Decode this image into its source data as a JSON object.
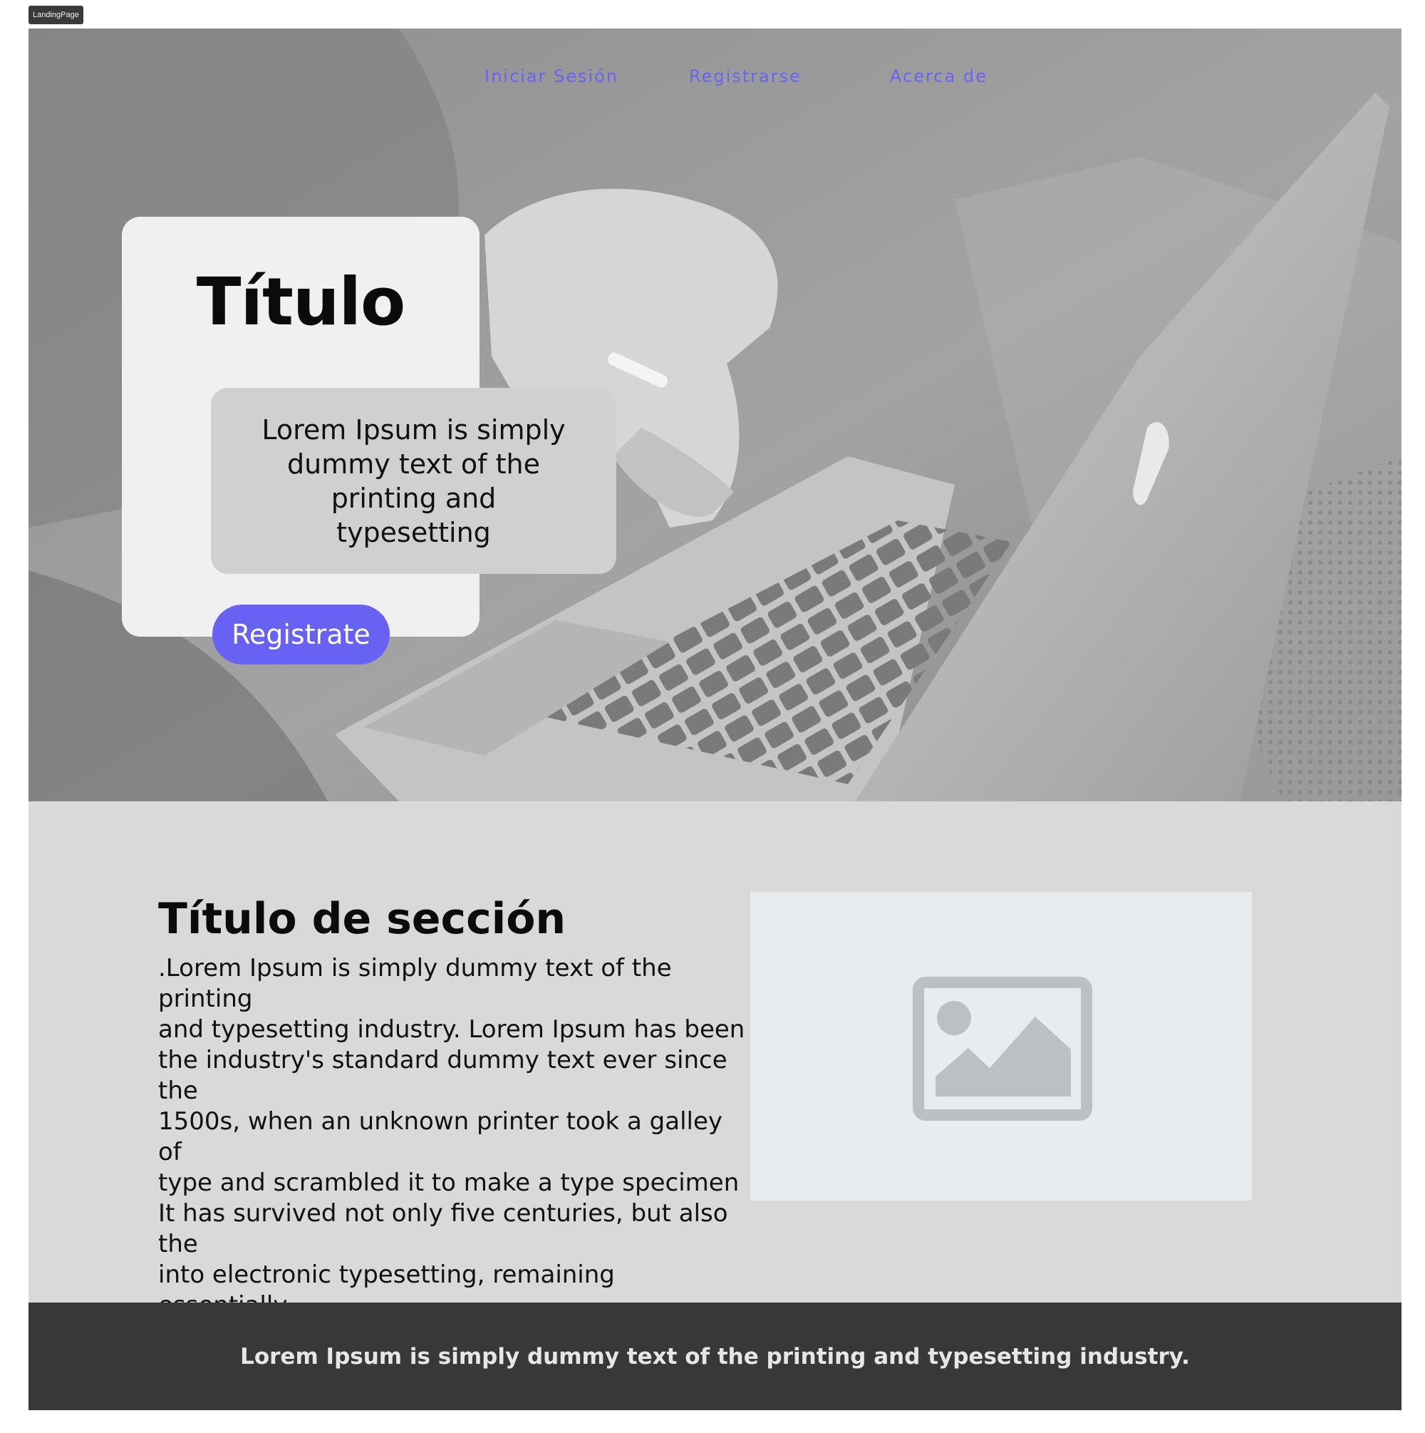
{
  "frame": {
    "label": "LandingPage"
  },
  "nav": {
    "login": "Iniciar Sesión",
    "register": "Registrarse",
    "about": "Acerca de"
  },
  "hero": {
    "title": "Título",
    "text": "Lorem Ipsum is simply dummy text of the printing and typesetting",
    "cta": "Registrate",
    "background_icon": "laptop-photo"
  },
  "section": {
    "title": "Título de sección",
    "body": ".Lorem Ipsum is simply dummy text of the printing\nand typesetting industry. Lorem Ipsum has been\n the industry's standard dummy text ever since the\n 1500s, when an unknown printer took a galley of\n type and scrambled it to make a type specimen\n It has survived not only five centuries, but also the\n into electronic typesetting, remaining essentially\nunchanged.",
    "image_icon": "image-icon"
  },
  "footer": {
    "text": "Lorem Ipsum is simply dummy text of the printing and typesetting industry."
  },
  "colors": {
    "accent": "#6762f4",
    "nav_link": "#6a63f5",
    "footer_bg": "#383838",
    "section_bg": "#d9d9d9",
    "card_bg": "#f0f0f0",
    "textbox_bg": "#d0d0d0"
  }
}
